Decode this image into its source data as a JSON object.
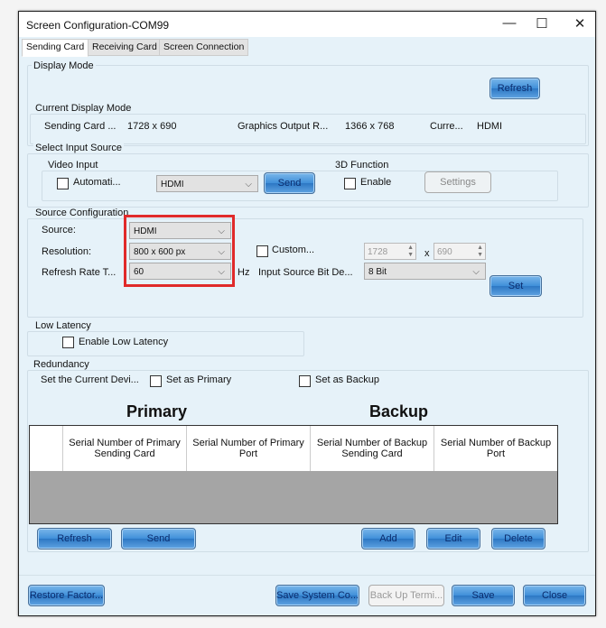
{
  "window": {
    "title": "Screen Configuration-COM99",
    "minimize": "—",
    "maximize": "☐",
    "close": "✕"
  },
  "tabs": [
    "Sending Card",
    "Receiving Card",
    "Screen Connection"
  ],
  "display_mode": {
    "label": "Display Mode",
    "refresh": "Refresh",
    "current_label": "Current Display Mode",
    "sending_card_label": "Sending Card ...",
    "sending_card_value": "1728 x 690",
    "graphics_label": "Graphics Output R...",
    "graphics_value": "1366 x 768",
    "current_label2": "Curre...",
    "current_value": "HDMI"
  },
  "input_source": {
    "label": "Select Input Source",
    "video_input": "Video Input",
    "auto_label": "Automati...",
    "video_select": "HDMI",
    "send": "Send",
    "function_3d": "3D Function",
    "enable": "Enable",
    "settings": "Settings"
  },
  "source_config": {
    "label": "Source Configuration",
    "source_label": "Source:",
    "source_value": "HDMI",
    "resolution_label": "Resolution:",
    "resolution_value": "800 x 600 px",
    "refresh_label": "Refresh Rate T...",
    "refresh_value": "60",
    "hz": "Hz",
    "custom_label": "Custom...",
    "custom_w": "1728",
    "x": "x",
    "custom_h": "690",
    "bit_label": "Input Source Bit De...",
    "bit_value": "8 Bit",
    "set": "Set"
  },
  "low_latency": {
    "label": "Low Latency",
    "enable": "Enable Low Latency"
  },
  "redundancy": {
    "label": "Redundancy",
    "set_current": "Set the Current Devi...",
    "set_primary": "Set as Primary",
    "set_backup": "Set as Backup",
    "primary": "Primary",
    "backup": "Backup",
    "columns": [
      "Serial Number of Primary Sending Card",
      "Serial Number of Primary Port",
      "Serial Number of Backup Sending Card",
      "Serial Number of Backup Port"
    ],
    "refresh": "Refresh",
    "send": "Send",
    "add": "Add",
    "edit": "Edit",
    "delete": "Delete"
  },
  "footer": {
    "restore": "Restore Factor...",
    "save_system": "Save System Co...",
    "backup": "Back Up Termi...",
    "save": "Save",
    "close": "Close"
  }
}
